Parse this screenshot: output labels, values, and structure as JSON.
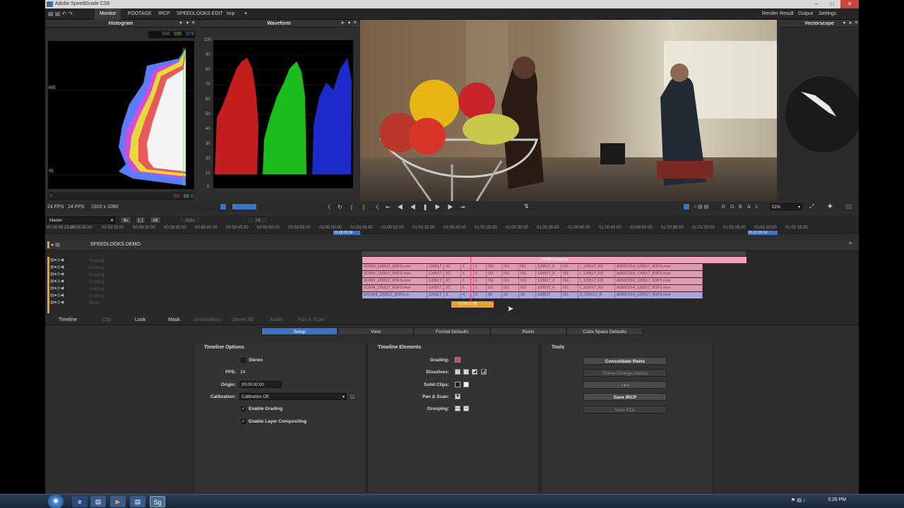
{
  "window": {
    "title": "Adobe SpeedGrade CS6"
  },
  "menubar": {
    "left": [
      "Monitor",
      "FOOTAGE",
      "IRCP",
      "SPEEDLOOKS EDIT",
      "ircp",
      "+"
    ],
    "right": [
      "Render Result",
      "Output",
      "Settings"
    ]
  },
  "histogram": {
    "title": "Histogram",
    "val_r": "998",
    "val_g": "996",
    "val_b": "979",
    "mark_top": "685",
    "mark_bottom": "95",
    "foot_r": "55",
    "foot_g": "88",
    "foot_b": "0"
  },
  "waveform": {
    "title": "Waveform",
    "scale": [
      "100",
      "90",
      "80",
      "70",
      "60",
      "50",
      "40",
      "30",
      "20",
      "10",
      "0"
    ]
  },
  "vectorscope": {
    "title": "Vectorscope"
  },
  "status": {
    "fps": "24 FPS",
    "fps2": "24 FPS",
    "res": "1920 x 1080",
    "zoom": "51%",
    "channels": [
      "R",
      "G",
      "B",
      "A",
      "L"
    ]
  },
  "timeline_bar": {
    "master": "Master",
    "btn_6s": "6s",
    "btn_all": "All",
    "btn_auto": "Auto",
    "btn_all2": "All",
    "timecodes": [
      "00:00:59:15:00",
      "00:59:20:00",
      "00:59:25:00",
      "00:59:30:00",
      "00:59:35:00",
      "00:59:40:00",
      "00:59:45:00",
      "00:59:50:00",
      "00:59:55:00",
      "01:00:00:00",
      "01:00:05:00",
      "01:00:10:00",
      "01:00:15:00",
      "01:00:20:00",
      "01:00:25:00",
      "01:00:30:00",
      "01:00:35:00",
      "01:00:40:00",
      "01:00:45:00",
      "01:00:50:00",
      "01:00:55:00",
      "01:01:00:00",
      "01:01:05:00",
      "01:01:10:00",
      "01:01:15:00"
    ],
    "start_tc": "01:00:00:00",
    "end_tc": "01:01:01:14"
  },
  "timeline": {
    "title": "SPEEDLOOKS DEMO",
    "track_labels": [
      "Grading",
      "Grading",
      "Grading",
      "Grading",
      "Grading",
      "Grading",
      "Shots"
    ],
    "grading_label": "Untitled grading",
    "clip_names": [
      "2C004_120517_R3FS.mov",
      "120517_I",
      "2C",
      "1",
      "1",
      "IS1",
      "IS1",
      "IS1",
      "120517_F",
      "IS1",
      "I_120517_R3",
      "A003C014_120517_R3FS.mov"
    ],
    "shot_names": [
      "02C004_120517_R3FS.m",
      "120517",
      "3",
      "4",
      "5",
      "05",
      "05",
      "05",
      "120517",
      "IS1",
      "3_120517_R",
      "A003C014_120517_R3FS.mov"
    ],
    "playhead_tc": "01:00:17:09"
  },
  "tabs": {
    "items": [
      "Timeline",
      "Clip",
      "Look",
      "Mask",
      "Annotations",
      "Stereo 3D",
      "Audio",
      "Pan & Scan"
    ]
  },
  "subtabs": {
    "items": [
      "Setup",
      "View",
      "Format Defaults",
      "Reels",
      "Color Space Defaults"
    ]
  },
  "timeline_options": {
    "title": "Timeline Options",
    "stereo": "Stereo",
    "fps_label": "FPS:",
    "fps_value": "24",
    "origin_label": "Origin:",
    "origin_value": "00:00:00:00",
    "calibration_label": "Calibration:",
    "calibration_value": "Calibration Off",
    "enable_grading": "Enable Grading",
    "enable_layer": "Enable Layer Compositing"
  },
  "timeline_elements": {
    "title": "Timeline Elements",
    "grading": "Grading:",
    "dissolves": "Dissolves:",
    "solid_clips": "Solid Clips:",
    "pan_scan": "Pan & Scan:",
    "grouping": "Grouping:"
  },
  "tools": {
    "title": "Tools",
    "consolidate": "Consolidate Reels",
    "scene_detect": "Scene Change Detect",
    "save_ircp": "Save IRCP",
    "save_edl": "Save EDL"
  },
  "taskbar": {
    "clock": "3:26 PM"
  },
  "colors": {
    "accent": "#3c73c8",
    "pink_clip": "#d99cb1",
    "shot_clip": "#a7a6d6",
    "playhead": "#e8a030"
  }
}
